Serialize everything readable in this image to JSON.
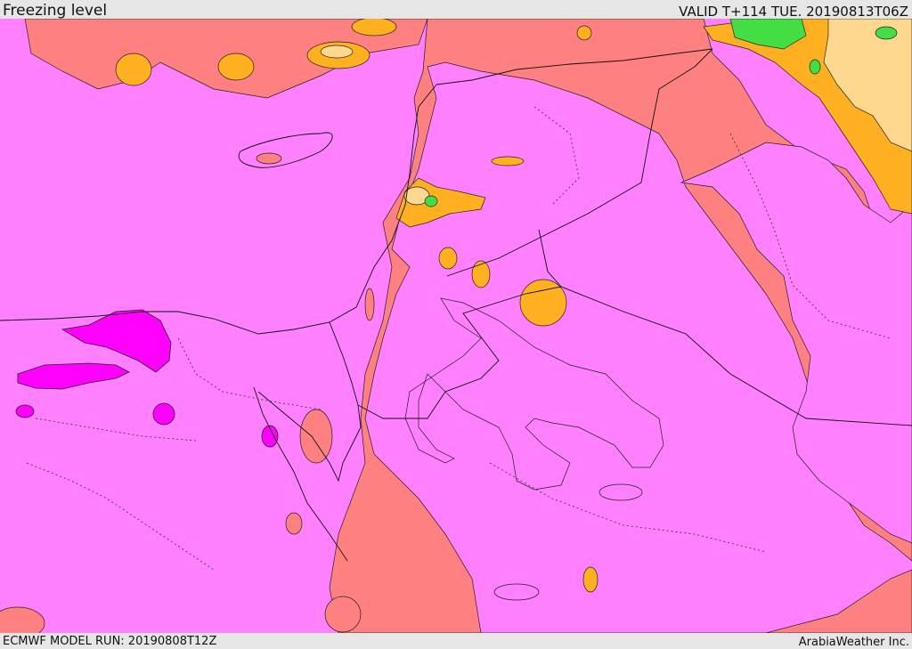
{
  "header": {
    "title": "Freezing level",
    "valid": "VALID T+114 TUE. 20190813T06Z"
  },
  "footer": {
    "model_run": "ECMWF MODEL RUN: 20190808T12Z",
    "credit": "ArabiaWeather Inc."
  },
  "map": {
    "colors": {
      "very_high": "#ff00ff",
      "high": "#ff80ff",
      "mid": "#ff8080",
      "lower": "#ffb020",
      "low": "#ffd890",
      "lowest": "#44dd44",
      "borders": "#111111"
    }
  }
}
